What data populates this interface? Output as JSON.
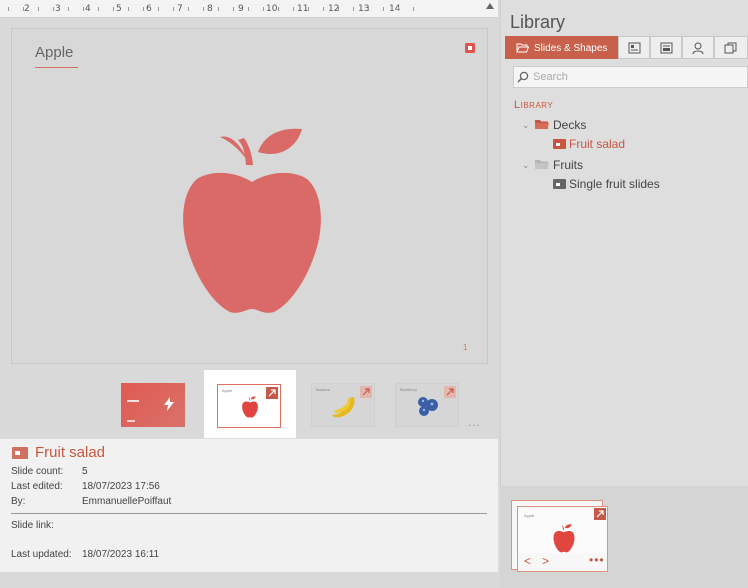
{
  "ruler": {
    "labels": [
      "2",
      "3",
      "4",
      "5",
      "6",
      "7",
      "8",
      "9",
      "10",
      "11",
      "12",
      "13",
      "14"
    ]
  },
  "slide": {
    "title": "Apple",
    "page_number": "1"
  },
  "thumbnails": {
    "more": "...",
    "caret": "^"
  },
  "deck_info": {
    "name": "Fruit salad",
    "slide_count_label": "Slide count:",
    "slide_count": "5",
    "last_edited_label": "Last edited:",
    "last_edited": "18/07/2023 17:56",
    "by_label": "By:",
    "by": "EmmanuellePoiffaut",
    "slide_link_label": "Slide link:",
    "last_updated_label": "Last updated:",
    "last_updated": "18/07/2023 16:11"
  },
  "library": {
    "heading": "Library",
    "tabs": {
      "slides_shapes": "Slides & Shapes"
    },
    "search_placeholder": "Search",
    "section_label": "Library",
    "tree": {
      "decks": "Decks",
      "fruit_salad": "Fruit salad",
      "fruits": "Fruits",
      "single_fruit_slides": "Single fruit slides"
    }
  },
  "preview": {
    "prev": "<",
    "next": ">",
    "more": "•••"
  },
  "colors": {
    "accent": "#c8563f",
    "apple": "#d96a67",
    "banana": "#e8b81e",
    "blueberry": "#3b5fa6"
  }
}
